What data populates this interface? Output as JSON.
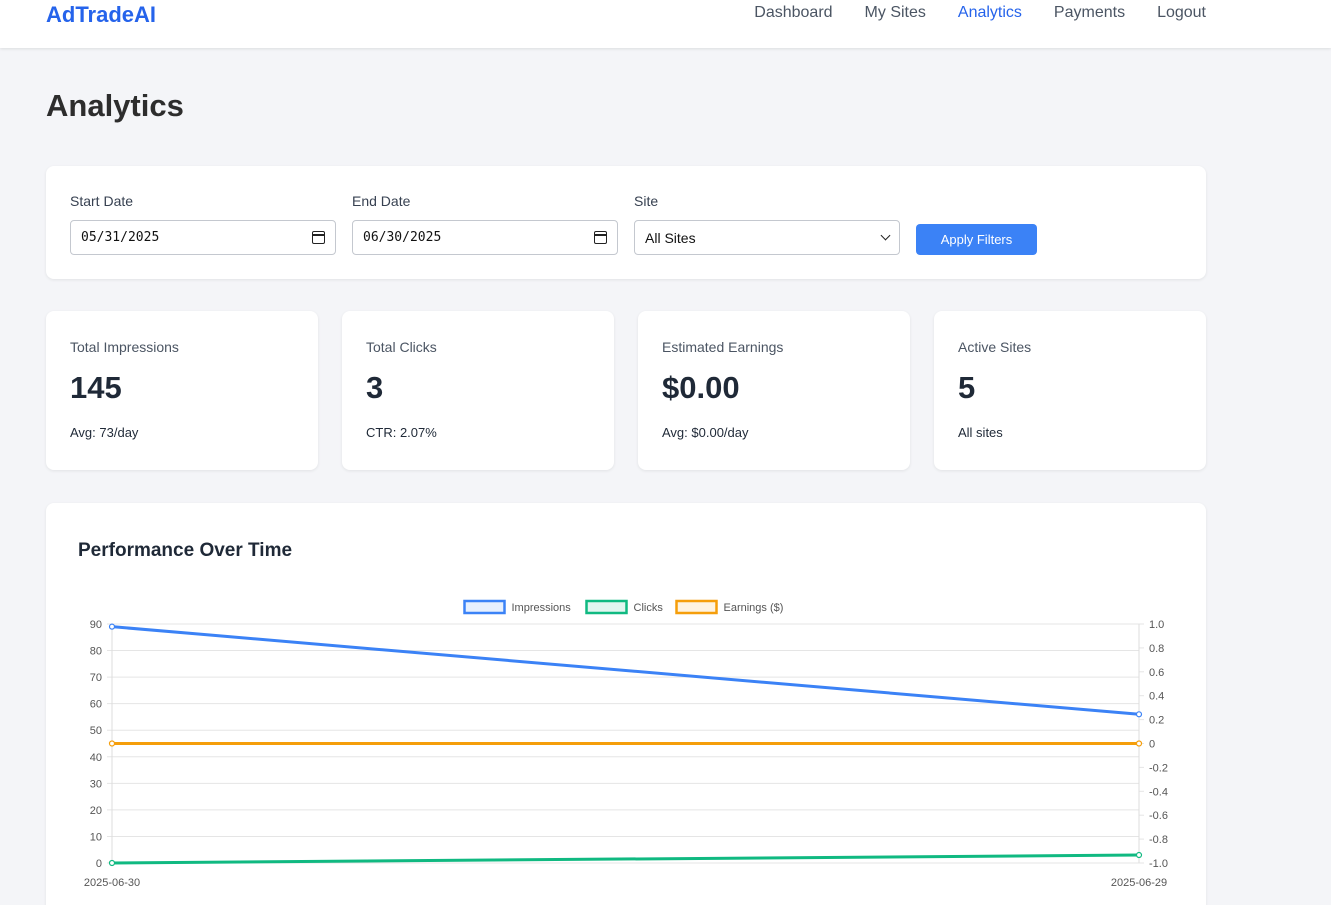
{
  "brand": "AdTradeAI",
  "nav": [
    {
      "label": "Dashboard",
      "active": false
    },
    {
      "label": "My Sites",
      "active": false
    },
    {
      "label": "Analytics",
      "active": true
    },
    {
      "label": "Payments",
      "active": false
    },
    {
      "label": "Logout",
      "active": false
    }
  ],
  "page_title": "Analytics",
  "filters": {
    "start_date_label": "Start Date",
    "start_date_value": "05/31/2025",
    "end_date_label": "End Date",
    "end_date_value": "06/30/2025",
    "site_label": "Site",
    "site_value": "All Sites",
    "apply_label": "Apply Filters"
  },
  "stats": [
    {
      "label": "Total Impressions",
      "value": "145",
      "sub": "Avg: 73/day"
    },
    {
      "label": "Total Clicks",
      "value": "3",
      "sub": "CTR: 2.07%"
    },
    {
      "label": "Estimated Earnings",
      "value": "$0.00",
      "sub": "Avg: $0.00/day"
    },
    {
      "label": "Active Sites",
      "value": "5",
      "sub": "All sites"
    }
  ],
  "chart_title": "Performance Over Time",
  "colors": {
    "accent": "#2563eb",
    "button": "#3b82f6",
    "impressions": "#3b82f6",
    "clicks": "#10b981",
    "earnings": "#f59e0b"
  },
  "chart_data": {
    "type": "line",
    "x": [
      "2025-06-30",
      "2025-06-29"
    ],
    "series": [
      {
        "name": "Impressions",
        "values": [
          89,
          56
        ],
        "axis": "left",
        "color": "#3b82f6"
      },
      {
        "name": "Clicks",
        "values": [
          0,
          3
        ],
        "axis": "left",
        "color": "#10b981"
      },
      {
        "name": "Earnings ($)",
        "values": [
          0,
          0
        ],
        "axis": "right",
        "color": "#f59e0b"
      }
    ],
    "ylim": [
      0,
      90
    ],
    "yticks": [
      0,
      10,
      20,
      30,
      40,
      50,
      60,
      70,
      80,
      90
    ],
    "y2lim": [
      -1,
      1
    ],
    "y2ticks": [
      "-1.0",
      "-0.8",
      "-0.6",
      "-0.4",
      "-0.2",
      "0",
      "0.2",
      "0.4",
      "0.6",
      "0.8",
      "1.0"
    ],
    "legend": "top",
    "grid": true
  }
}
